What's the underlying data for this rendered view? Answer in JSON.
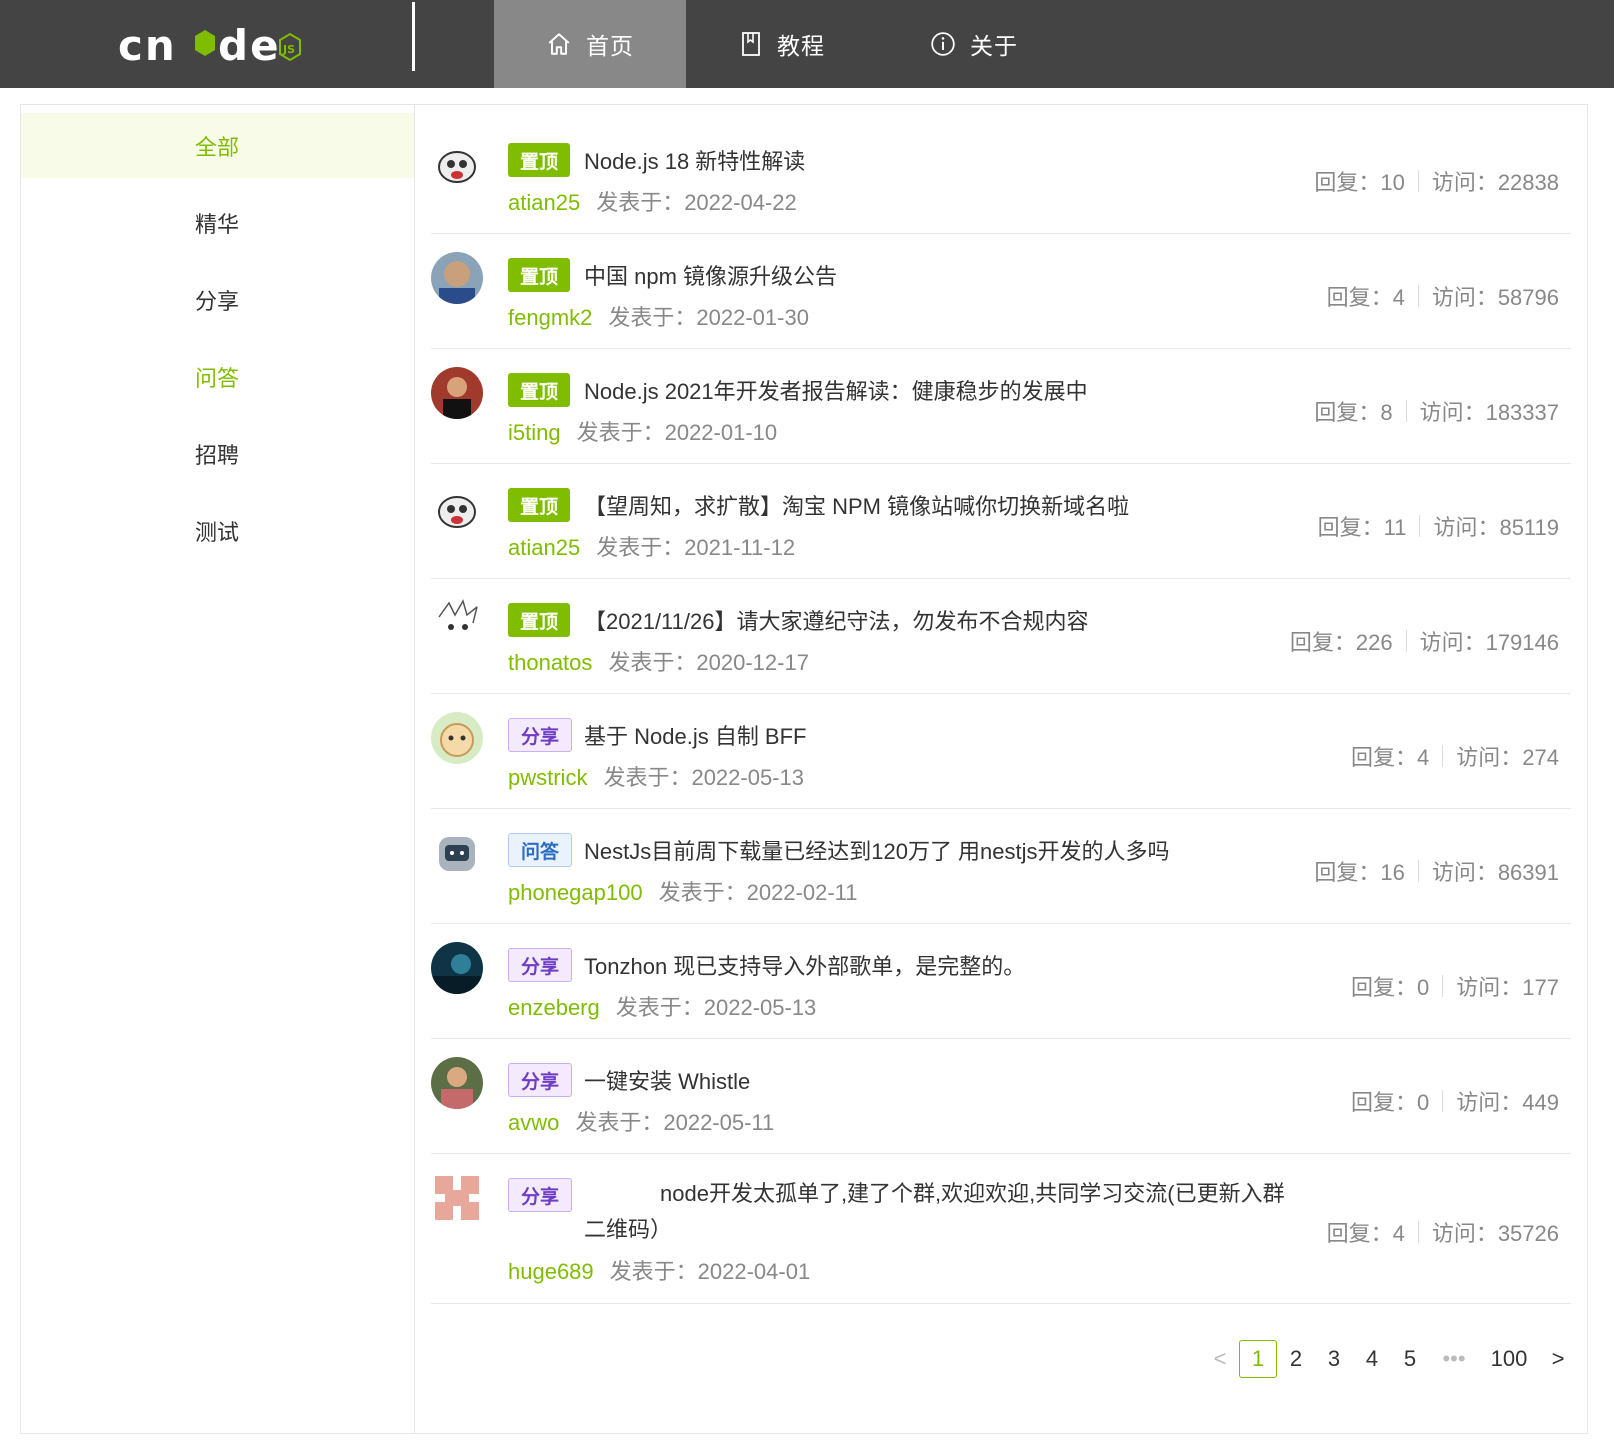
{
  "header": {
    "logo_text": "cnode",
    "logo_badge": "JS",
    "tabs": [
      {
        "label": "首页",
        "icon": "home-icon",
        "active": true
      },
      {
        "label": "教程",
        "icon": "book-icon",
        "active": false
      },
      {
        "label": "关于",
        "icon": "info-icon",
        "active": false
      }
    ]
  },
  "sidebar": {
    "items": [
      {
        "label": "全部"
      },
      {
        "label": "精华"
      },
      {
        "label": "分享"
      },
      {
        "label": "问答"
      },
      {
        "label": "招聘"
      },
      {
        "label": "测试"
      }
    ]
  },
  "topics": [
    {
      "tag": "置顶",
      "title": "Node.js 18 新特性解读",
      "author": "atian25",
      "posted": "发表于：2022-04-22",
      "replies": "回复：10",
      "visits": "访问：22838"
    },
    {
      "tag": "置顶",
      "title": "中国 npm 镜像源升级公告",
      "author": "fengmk2",
      "posted": "发表于：2022-01-30",
      "replies": "回复：4",
      "visits": "访问：58796"
    },
    {
      "tag": "置顶",
      "title": "Node.js 2021年开发者报告解读：健康稳步的发展中",
      "author": "i5ting",
      "posted": "发表于：2022-01-10",
      "replies": "回复：8",
      "visits": "访问：183337"
    },
    {
      "tag": "置顶",
      "title": "【望周知，求扩散】淘宝 NPM 镜像站喊你切换新域名啦",
      "author": "atian25",
      "posted": "发表于：2021-11-12",
      "replies": "回复：11",
      "visits": "访问：85119"
    },
    {
      "tag": "置顶",
      "title": "【2021/11/26】请大家遵纪守法，勿发布不合规内容",
      "author": "thonatos",
      "posted": "发表于：2020-12-17",
      "replies": "回复：226",
      "visits": "访问：179146"
    },
    {
      "tag": "分享",
      "title": "基于 Node.js 自制 BFF",
      "author": "pwstrick",
      "posted": "发表于：2022-05-13",
      "replies": "回复：4",
      "visits": "访问：274"
    },
    {
      "tag": "问答",
      "title": "NestJs目前周下载量已经达到120万了 用nestjs开发的人多吗",
      "author": "phonegap100",
      "posted": "发表于：2022-02-11",
      "replies": "回复：16",
      "visits": "访问：86391"
    },
    {
      "tag": "分享",
      "title": "Tonzhon 现已支持导入外部歌单，是完整的。",
      "author": "enzeberg",
      "posted": "发表于：2022-05-13",
      "replies": "回复：0",
      "visits": "访问：177"
    },
    {
      "tag": "分享",
      "title": "一键安装 Whistle",
      "author": "avwo",
      "posted": "发表于：2022-05-11",
      "replies": "回复：0",
      "visits": "访问：449"
    },
    {
      "tag": "分享",
      "title": "node开发太孤单了,建了个群,欢迎欢迎,共同学习交流(已更新入群二维码）",
      "author": "huge689",
      "posted": "发表于：2022-04-01",
      "replies": "回复：4",
      "visits": "访问：35726"
    }
  ],
  "pagination": {
    "prev": "<",
    "pages": [
      "1",
      "2",
      "3",
      "4",
      "5"
    ],
    "ellipsis": "•••",
    "last": "100",
    "next": ">",
    "current": "1"
  },
  "colors": {
    "accent": "#80bd01",
    "header_bg": "#444444",
    "active_tab": "#888888"
  }
}
